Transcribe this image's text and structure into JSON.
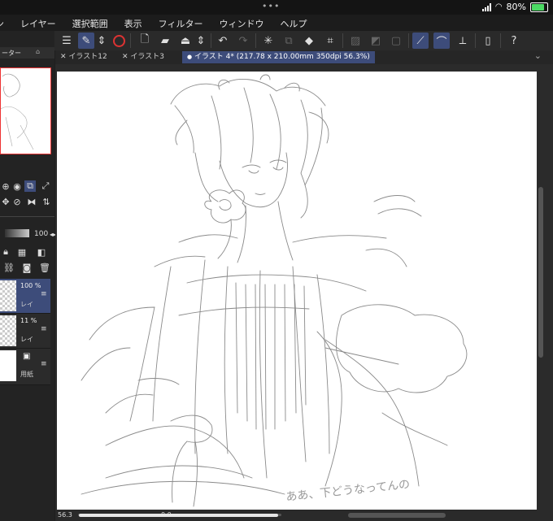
{
  "status": {
    "battery": "80%"
  },
  "menu": [
    "ン",
    "レイヤー",
    "選択範囲",
    "表示",
    "フィルター",
    "ウィンドウ",
    "ヘルプ"
  ],
  "toolbar_icons": [
    "hamburger-icon",
    "edit-frame-icon",
    "up-down-icon",
    "capture-icon",
    "new-file-icon",
    "open-folder-icon",
    "save-icon",
    "up-down-icon",
    "undo-icon",
    "redo-icon",
    "loading-icon",
    "transform-icon",
    "fill-icon",
    "crop-icon",
    "layer-mask-icon",
    "mask-icon",
    "frame-icon",
    "pen-icon",
    "brush-icon",
    "ruler-icon",
    "phone-icon",
    "help-icon"
  ],
  "left_panel": {
    "tab_label": "ーター",
    "opacity": "100"
  },
  "tabs": [
    {
      "label": "イラスト12",
      "close": "✕"
    },
    {
      "label": "イラスト3",
      "close": "✕"
    },
    {
      "label": "イラスト 4* (217.78 x 210.00mm 350dpi 56.3%)",
      "close": "●"
    }
  ],
  "layers": [
    {
      "opacity": "100 %",
      "name": "レイ"
    },
    {
      "opacity": "11 %",
      "name": "レイ"
    },
    {
      "opacity": "",
      "name": "用紙"
    }
  ],
  "bottom": {
    "zoom": "56.3",
    "rotation": "0.0"
  },
  "handwriting": "ああ、下どうなってんの"
}
